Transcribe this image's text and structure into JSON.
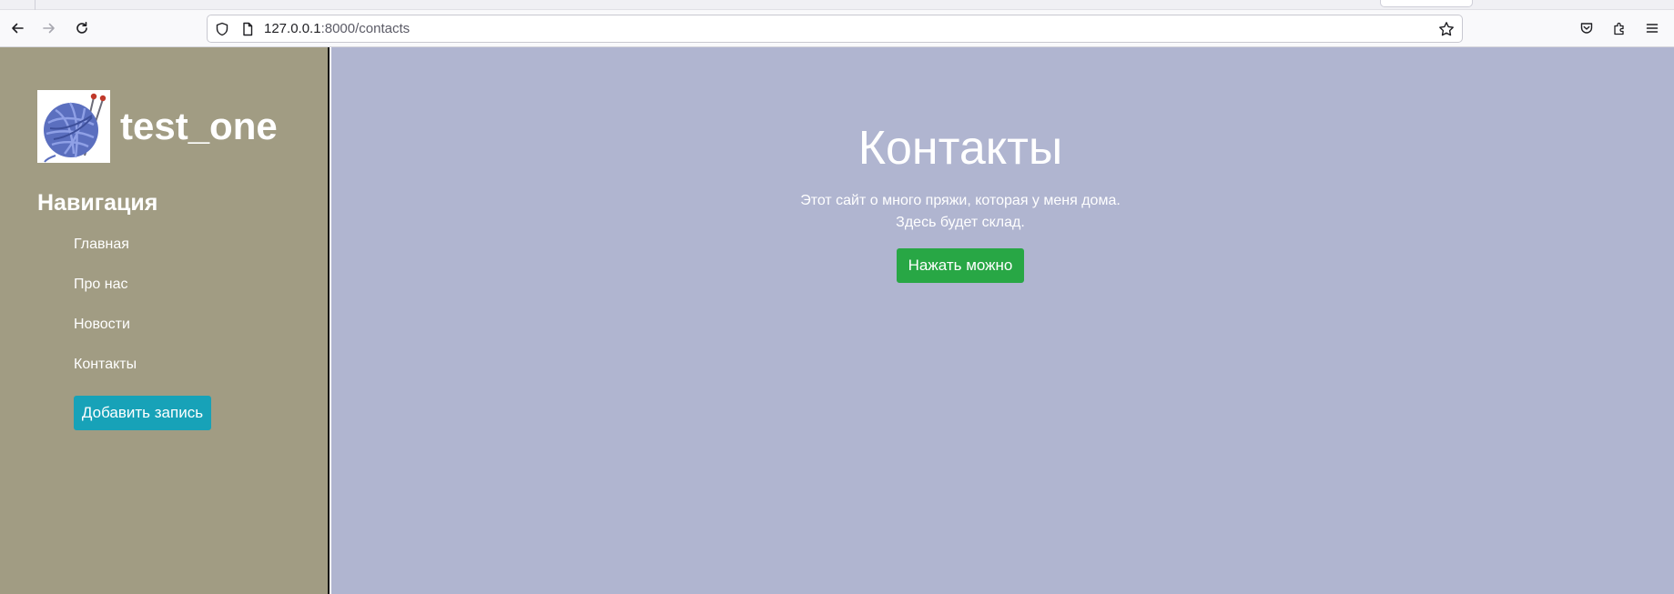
{
  "browser": {
    "url_host": "127.0.0.1",
    "url_path": ":8000/contacts"
  },
  "sidebar": {
    "brand_name": "test_one",
    "nav_heading": "Навигация",
    "nav_items": [
      {
        "label": "Главная"
      },
      {
        "label": "Про нас"
      },
      {
        "label": "Новости"
      },
      {
        "label": "Контакты"
      }
    ],
    "add_button_label": "Добавить запись",
    "background": "#a19c83"
  },
  "main": {
    "title": "Контакты",
    "description_lines": [
      "Этот сайт о много пряжи, которая у меня дома.",
      "Здесь будет склад."
    ],
    "cta_label": "Нажать можно",
    "background": "#b0b5d0"
  },
  "colors": {
    "add_button": "#17a2b8",
    "cta_button": "#28a745"
  },
  "icons": [
    "back-icon",
    "forward-icon",
    "reload-icon",
    "shield-icon",
    "page-icon",
    "bookmark-star-icon",
    "pocket-icon",
    "extensions-icon",
    "menu-icon",
    "yarn-ball-logo"
  ]
}
